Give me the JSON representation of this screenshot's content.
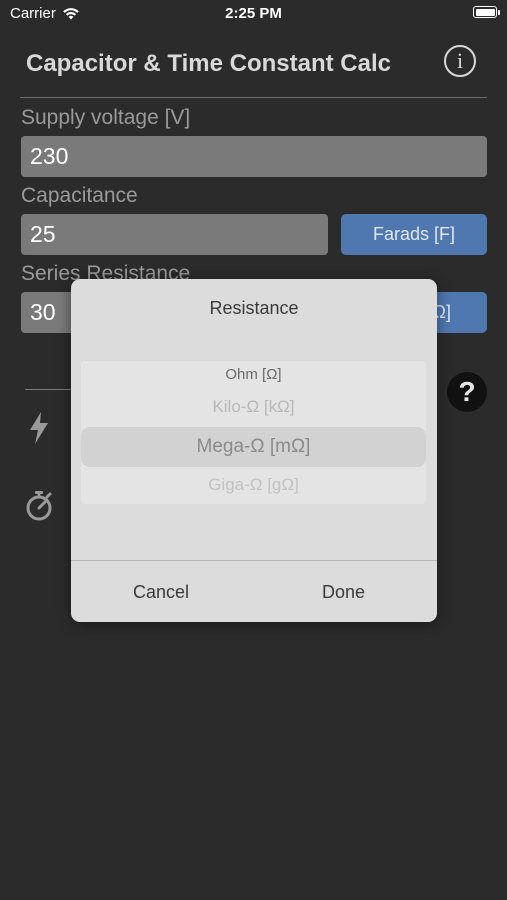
{
  "status_bar": {
    "carrier": "Carrier",
    "time": "2:25 PM"
  },
  "header": {
    "title": "Capacitor & Time Constant Calc",
    "info_glyph": "i"
  },
  "fields": {
    "supply_voltage": {
      "label": "Supply voltage [V]",
      "value": "230"
    },
    "capacitance": {
      "label": "Capacitance",
      "value": "25",
      "unit": "Farads [F]"
    },
    "series_resistance": {
      "label": "Series Resistance",
      "value": "30",
      "unit_partial": "Ω]"
    }
  },
  "help": {
    "glyph": "?"
  },
  "dialog": {
    "title": "Resistance",
    "options": [
      "Ohm [Ω]",
      "Kilo-Ω [kΩ]",
      "Mega-Ω [mΩ]",
      "Giga-Ω [gΩ]"
    ],
    "selected": "Mega-Ω [mΩ]",
    "cancel_label": "Cancel",
    "done_label": "Done"
  },
  "icons": {
    "status": [
      "wifi-icon",
      "battery-icon"
    ],
    "results": [
      "bolt-icon",
      "timer-icon"
    ],
    "header": [
      "info-icon"
    ]
  },
  "colors": {
    "background": "#2b2b2b",
    "accent": "#4f78b0",
    "dialog": "#dcdcdc"
  }
}
